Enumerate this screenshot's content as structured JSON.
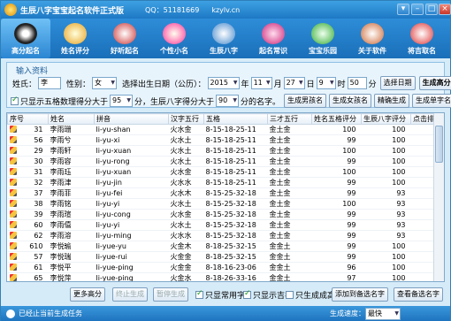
{
  "window": {
    "title": "生辰八字宝宝起名软件正式版",
    "qq": "QQ：51181669",
    "site": "kzylv.cn"
  },
  "toolbar": [
    "高分起名",
    "姓名评分",
    "好听起名",
    "个性小名",
    "生辰八字",
    "起名常识",
    "宝宝乐园",
    "关于软件",
    "将吉取名"
  ],
  "input": {
    "caption": "输入资料",
    "surname_label": "姓氏：",
    "surname": "李",
    "gender_label": "性别：",
    "gender": "女",
    "birth_label": "选择出生日期（公历）：",
    "year": "2015",
    "year_unit": "年",
    "month": "11",
    "month_unit": "月",
    "day": "27",
    "day_unit": "日",
    "hour": "9",
    "hour_unit": "时",
    "minute": "50",
    "minute_unit": "分",
    "pick_date": "选择日期",
    "gen_high": "生成高分名",
    "only_show_label": "只显示五格数理得分大于",
    "score1": "95",
    "mid_label": "分，生辰八字得分大于",
    "score2": "90",
    "end_label": "分的名字。",
    "boy_names": "生成男孩名",
    "girl_names": "生成女孩名",
    "exact": "精确生成",
    "single": "生成单字名"
  },
  "columns": [
    "序号",
    "姓名",
    "拼音",
    "汉字五行",
    "五格",
    "三才五行",
    "姓名五格评分",
    "生辰八字评分",
    "点击排序"
  ],
  "rows": [
    [
      "31",
      "李雨珊",
      "li-yu-shan",
      "火水金",
      "8-15-18-25-11",
      "金土金",
      "100",
      "100"
    ],
    [
      "56",
      "李雨兮",
      "li-yu-xi",
      "火水土",
      "8-15-18-25-11",
      "金土金",
      "99",
      "100"
    ],
    [
      "29",
      "李雨轩",
      "li-yu-xuan",
      "火水土",
      "8-15-18-25-11",
      "金土金",
      "100",
      "100"
    ],
    [
      "30",
      "李雨容",
      "li-yu-rong",
      "火水土",
      "8-15-18-25-11",
      "金土金",
      "99",
      "100"
    ],
    [
      "31",
      "李雨珏",
      "li-yu-xuan",
      "火水金",
      "8-15-18-25-11",
      "金土金",
      "100",
      "100"
    ],
    [
      "32",
      "李雨津",
      "li-yu-jin",
      "火水水",
      "8-15-18-25-11",
      "金土金",
      "99",
      "100"
    ],
    [
      "37",
      "李雨菲",
      "li-yu-fei",
      "火水木",
      "8-15-25-32-18",
      "金土金",
      "99",
      "93"
    ],
    [
      "38",
      "李雨铭",
      "li-yu-yi",
      "火水土",
      "8-15-25-32-18",
      "金土金",
      "100",
      "93"
    ],
    [
      "39",
      "李雨瑄",
      "li-yu-cong",
      "火水金",
      "8-15-25-32-18",
      "金土金",
      "99",
      "93"
    ],
    [
      "60",
      "李雨僖",
      "li-yu-yi",
      "火水土",
      "8-15-25-32-18",
      "金土金",
      "99",
      "93"
    ],
    [
      "62",
      "李雨溶",
      "li-yu-ming",
      "火水水",
      "8-15-25-32-18",
      "金土金",
      "99",
      "93"
    ],
    [
      "610",
      "李悦瑜",
      "li-yue-yu",
      "火金木",
      "8-18-25-32-15",
      "金金土",
      "99",
      "100"
    ],
    [
      "57",
      "李悦瑞",
      "li-yue-rui",
      "火金金",
      "8-18-25-32-15",
      "金金土",
      "99",
      "100"
    ],
    [
      "61",
      "李悦平",
      "li-yue-ping",
      "火金金",
      "8-18-16-23-06",
      "金金土",
      "96",
      "100"
    ],
    [
      "65",
      "李悦萍",
      "li-yue-ping",
      "火金水",
      "8-18-26-33-16",
      "金金土",
      "97",
      "100"
    ],
    [
      "57",
      "李悦慧",
      "li-yue-hui",
      "火金土",
      "8-18-26-33-16",
      "金金土",
      "95",
      "100"
    ]
  ],
  "bottom": {
    "more": "更多高分",
    "stop": "终止生成",
    "pause": "暂停生成",
    "common": "只显常用字",
    "lucky": "只显示吉名",
    "hide_wuxing": "只生成成高",
    "add_fav": "添加到备选名字",
    "view_fav": "查看备选名字"
  },
  "status": {
    "text": "已经止当前生成任务",
    "speed_label": "生成速度：",
    "speed": "最快"
  }
}
